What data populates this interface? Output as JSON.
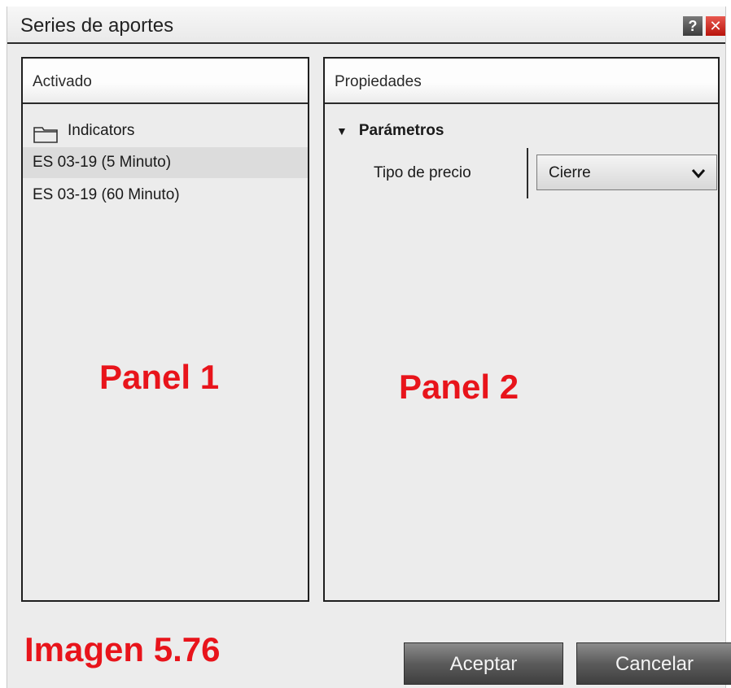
{
  "window": {
    "title": "Series de aportes",
    "help_label": "?",
    "close_label": "✕"
  },
  "panel1": {
    "header": "Activado",
    "folder_label": "Indicators",
    "items": [
      "ES 03-19 (5 Minuto)",
      "ES 03-19 (60 Minuto)"
    ],
    "overlay_label": "Panel 1"
  },
  "panel2": {
    "header": "Propiedades",
    "section_title": "Parámetros",
    "property_label": "Tipo de precio",
    "property_value": "Cierre",
    "overlay_label": "Panel 2"
  },
  "footer": {
    "caption": "Imagen 5.76",
    "accept_label": "Aceptar",
    "cancel_label": "Cancelar"
  },
  "colors": {
    "overlay_red": "#e8141b",
    "close_red": "#c4190f",
    "button_dark": "#4a4a4a"
  },
  "icons": {
    "folder": "folder-icon",
    "triangle": "triangle-down-icon",
    "chevron": "chevron-down-icon",
    "help": "help-icon",
    "close": "close-icon"
  }
}
